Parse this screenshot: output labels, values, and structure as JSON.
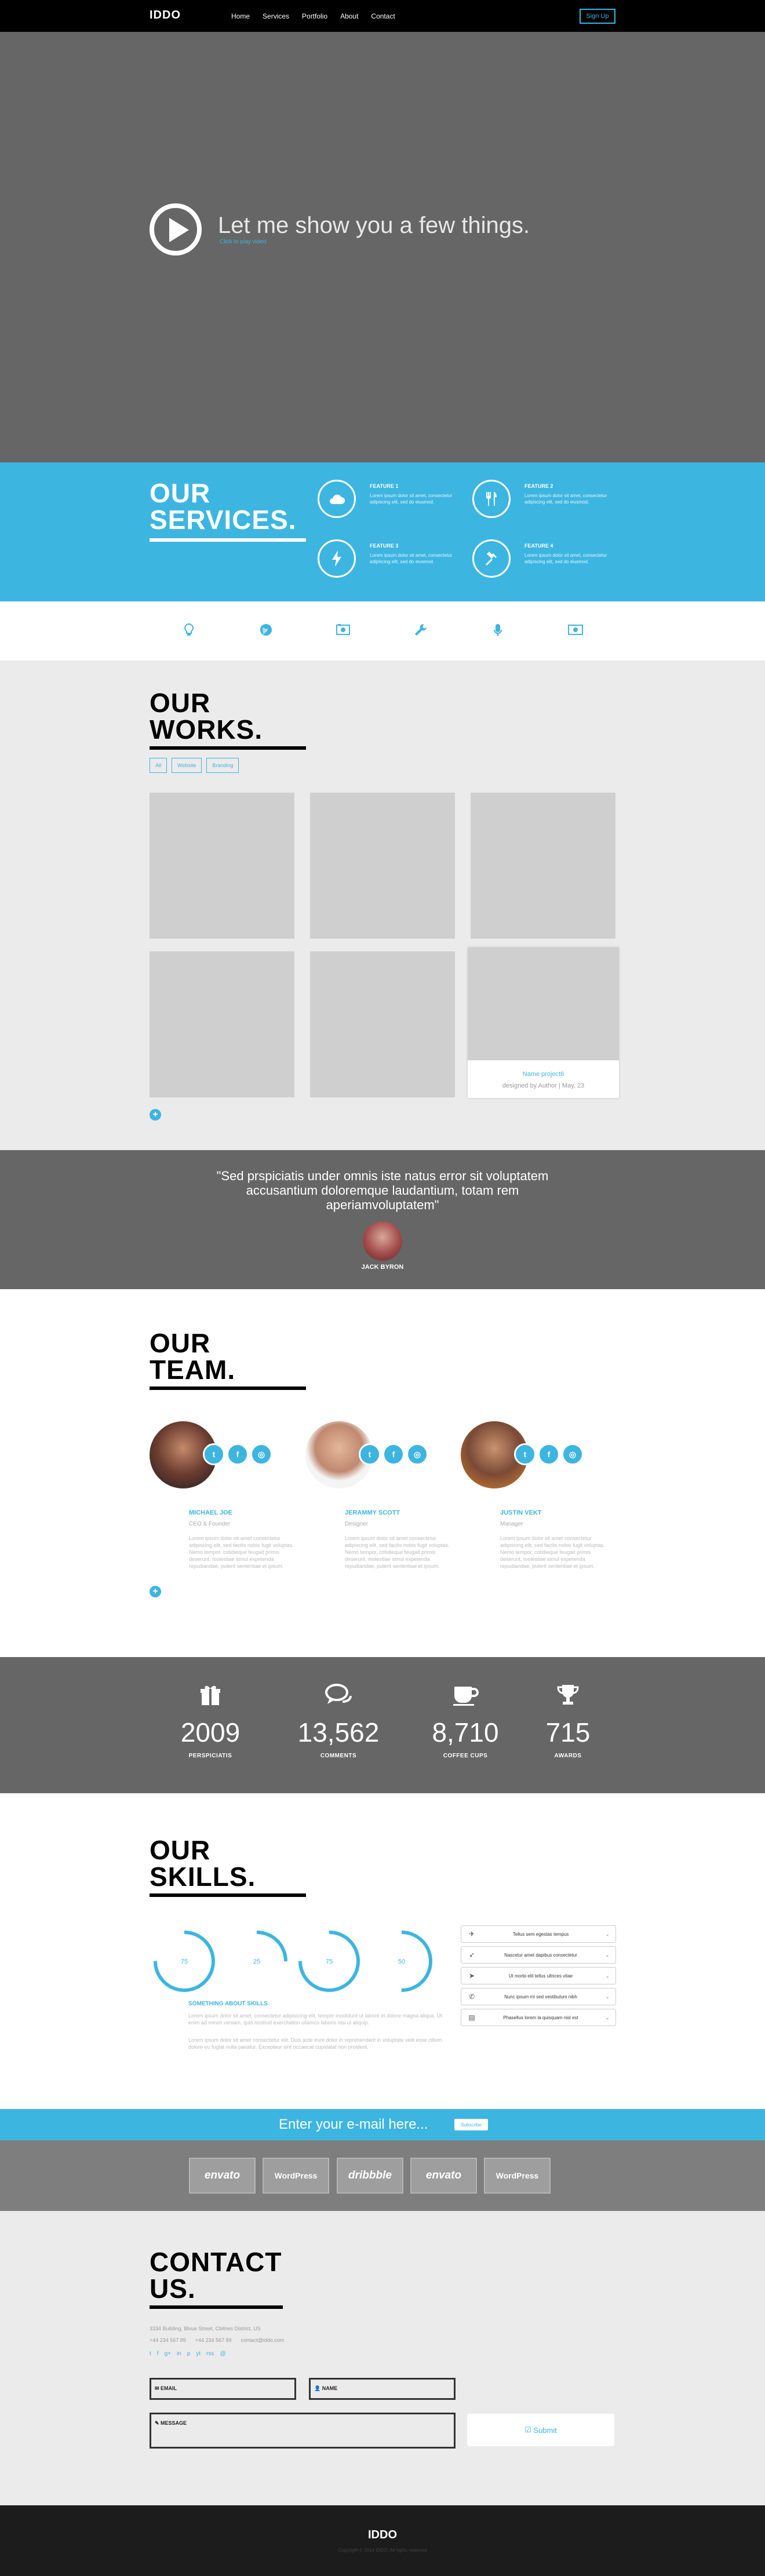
{
  "nav": {
    "logo": "IDDO",
    "items": [
      "Home",
      "Services",
      "Portfolio",
      "About",
      "Contact"
    ],
    "signup": "Sign Up"
  },
  "hero": {
    "title": "Let me show you a few things.",
    "subtitle": "Click to play video"
  },
  "services": {
    "title_line1": "OUR",
    "title_line2": "SERVICES.",
    "features": [
      {
        "icon": "cloud-icon",
        "title": "FEATURE 1",
        "desc": "Lorem ipsum dolor sit amet, consectetur adipiscing elit, sed do eiusmod."
      },
      {
        "icon": "cutlery-icon",
        "title": "FEATURE 2",
        "desc": "Lorem ipsum dolor sit amet, consectetur adipiscing elit, sed do eiusmod."
      },
      {
        "icon": "lightning-icon",
        "title": "FEATURE 3",
        "desc": "Lorem ipsum dolor sit amet, consectetur adipiscing elit, sed do eiusmod."
      },
      {
        "icon": "gavel-icon",
        "title": "FEATURE 4",
        "desc": "Lorem ipsum dolor sit amet, consectetur adipiscing elit, sed do eiusmod."
      }
    ]
  },
  "icon_row": {
    "icons": [
      "lightbulb-icon",
      "globe-icon",
      "camera-icon",
      "wrench-icon",
      "microphone-icon",
      "money-icon"
    ],
    "accent": "#3db5e1"
  },
  "works": {
    "title_line1": "OUR",
    "title_line2": "WORKS.",
    "filters": [
      "All",
      "Website",
      "Branding"
    ],
    "hover_item": {
      "name": "Name project6",
      "meta": "designed by Author | May, 23"
    }
  },
  "testimonial": {
    "quote": "\"Sed prspiciatis under omnis iste natus error sit voluptatem accusantium doloremque laudantium, totam rem aperiamvoluptatem\"",
    "author": "JACK BYRON"
  },
  "team": {
    "title_line1": "OUR",
    "title_line2": "TEAM.",
    "members": [
      {
        "name": "MICHAEL JOE",
        "role": "CEO & Founder",
        "bio": "Lorem ipsum dolor sit amet consectetur adipiscing elit, sed facilis nobis fugit voluptas. Nemo tempor, cotidieque feugait primis deserunt, molestiae simul expetenda repudiandae, putent sententiae et ipsum."
      },
      {
        "name": "JERAMMY SCOTT",
        "role": "Designer",
        "bio": "Lorem ipsum dolor sit amet consectetur adipiscing elit, sed facilis nobis fugit voluptas. Nemo tempor, cotidieque feugait primis deserunt, molestiae simul expetenda repudiandae, putent sententiae et ipsum."
      },
      {
        "name": "JUSTIN VEKT",
        "role": "Manager",
        "bio": "Lorem ipsum dolor sit amet consectetur adipiscing elit, sed facilis nobis fugit voluptas. Nemo tempor, cotidieque feugait primis deserunt, molestiae simul expetenda repudiandae, putent sententiae et ipsum."
      }
    ]
  },
  "stats": [
    {
      "icon": "gift-icon",
      "value": "2009",
      "label": "PERSPICIATIS"
    },
    {
      "icon": "comments-icon",
      "value": "13,562",
      "label": "COMMENTS"
    },
    {
      "icon": "coffee-cup-icon",
      "value": "8,710",
      "label": "COFFEE CUPS"
    },
    {
      "icon": "trophy-icon",
      "value": "715",
      "label": "AWARDS"
    }
  ],
  "skills": {
    "title_line1": "OUR",
    "title_line2": "SKILLS.",
    "rings": [
      75,
      25,
      75,
      50
    ],
    "heading": "SOMETHING ABOUT SKILLS",
    "para1": "Lorem ipsum dolor sit amet, consectetur adipisicing elit, tempor incididunt ut labore et dolore magna aliqua. Ut enim ad minim veniam, quis nostrud exercitation ullamco laboris nisi ut aliquip.",
    "para2": "Lorem ipsum dolor sit amet consectetur elit. Duis aute irure dolor in reprehenderit in voluptate velit esse cillum dolore eu fugiat nulla pariatur. Excepteur sint occaecat cupidatat non proident.",
    "accordion": [
      {
        "icon": "plane-icon",
        "label": "Tellus sem egestas tempus"
      },
      {
        "icon": "rocket-icon",
        "label": "Nascetur amet dapibus consectetur"
      },
      {
        "icon": "send-icon",
        "label": "Ut morbi elit tellus ultrices vitae"
      },
      {
        "icon": "phone-icon",
        "label": "Nunc ipsum mi sed vestibulum nibh"
      },
      {
        "icon": "book-icon",
        "label": "Phasellus lorem la quisquam nisl est"
      }
    ]
  },
  "subscribe": {
    "text": "Enter your e-mail here...",
    "button": "Subscribe"
  },
  "clients": [
    "envato",
    "WordPress",
    "dribbble",
    "envato",
    "WordPress"
  ],
  "contact": {
    "title_line1": "CONTACT",
    "title_line2": "US.",
    "address": "3334 Building, Blvue Street, Cbitnes District, US",
    "phone1": "+44 234 567 89",
    "phone2": "+44 234 567 89",
    "email": "contact@iddo.com",
    "social": [
      "t",
      "f",
      "g+",
      "in",
      "p",
      "yt",
      "rss",
      "@"
    ],
    "email_label": "EMAIL",
    "name_label": "NAME",
    "message_label": "MESSAGE",
    "submit": "Submit"
  },
  "footer": {
    "logo": "IDDO",
    "copyright": "Copyright © 2014 IDDO. All rights reserved"
  }
}
